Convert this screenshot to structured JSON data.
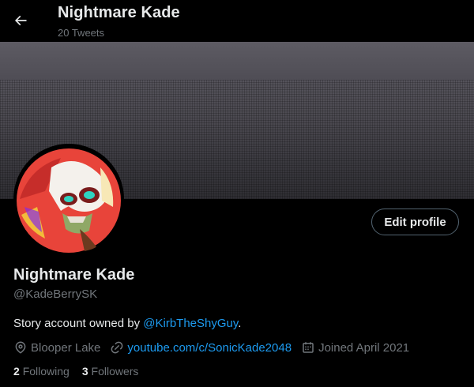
{
  "header": {
    "title": "Nightmare Kade",
    "tweets_count": "20 Tweets"
  },
  "profile": {
    "name": "Nightmare Kade",
    "handle": "@KadeBerrySK",
    "edit_button": "Edit profile",
    "bio_prefix": "Story account owned by ",
    "bio_mention": "@KirbTheShyGuy",
    "bio_suffix": ".",
    "location": "Blooper Lake",
    "website": "youtube.com/c/SonicKade2048",
    "joined": "Joined April 2021",
    "following_count": "2",
    "following_label": "Following",
    "followers_count": "3",
    "followers_label": "Followers"
  },
  "colors": {
    "background": "#000000",
    "text": "#e7e9ea",
    "muted": "#71767b",
    "link": "#1d9bf0",
    "button_border": "#536471"
  },
  "icons": [
    "back-arrow-icon",
    "location-pin-icon",
    "link-icon",
    "calendar-icon"
  ]
}
